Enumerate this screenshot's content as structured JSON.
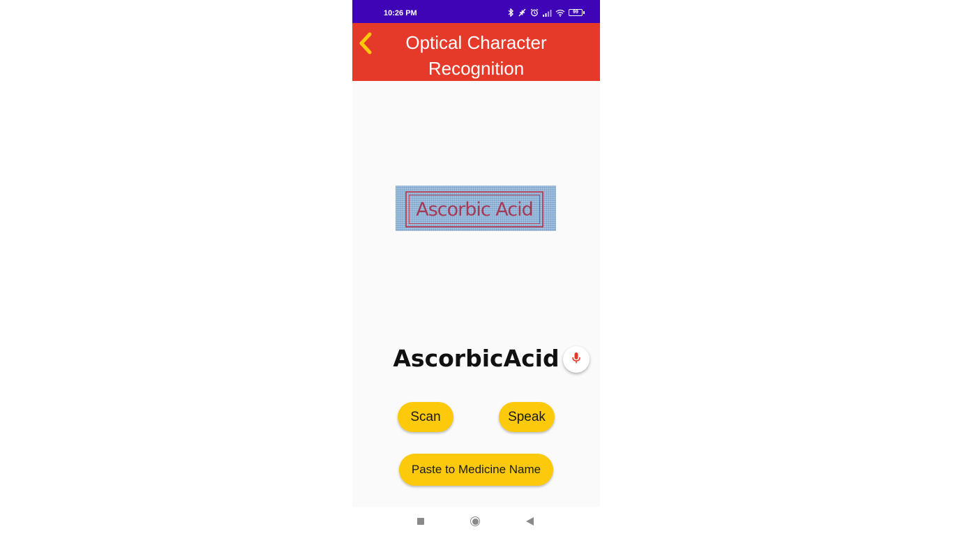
{
  "status_bar": {
    "time": "10:26 PM",
    "icons": [
      "bluetooth-icon",
      "dnd-icon",
      "alarm-icon",
      "signal-icon",
      "wifi-icon",
      "battery-icon"
    ],
    "battery": "99",
    "background": "#3f04b6"
  },
  "app_bar": {
    "title": "Optical Character Recognition",
    "back_icon": "chevron-left-icon",
    "background": "#e53a2a",
    "back_color": "#fdca0b"
  },
  "scanned_image": {
    "text": "Ascorbic Acid"
  },
  "result": {
    "text": "AscorbicAcid",
    "mic_icon": "microphone-icon"
  },
  "buttons": {
    "scan": "Scan",
    "speak": "Speak",
    "paste": "Paste to Medicine Name",
    "color": "#fdca0b"
  },
  "nav_bar": {
    "icons": [
      "recents-icon",
      "home-icon",
      "back-icon"
    ]
  }
}
